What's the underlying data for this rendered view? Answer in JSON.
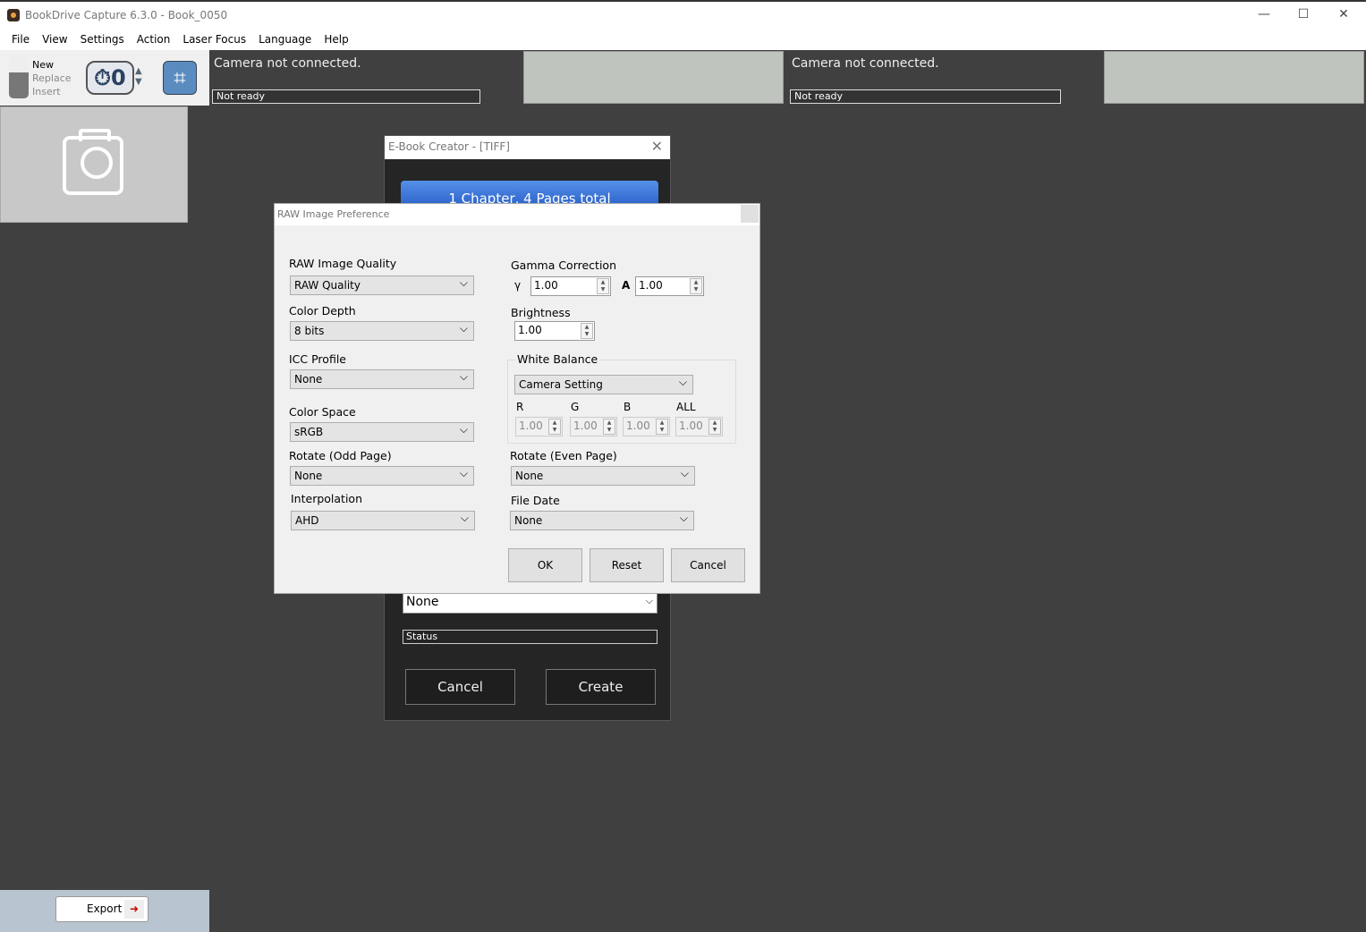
{
  "window": {
    "title": "BookDrive Capture 6.3.0 - Book_0050",
    "minimize": "—",
    "maximize": "☐",
    "close": "✕"
  },
  "menu": [
    "File",
    "View",
    "Settings",
    "Action",
    "Laser Focus",
    "Language",
    "Help"
  ],
  "toolbar": {
    "modes": [
      "New",
      "Replace",
      "Insert"
    ],
    "timer_value": "0",
    "crop_icon": "crop-icon"
  },
  "cameras": [
    {
      "message": "Camera not connected.",
      "status": "Not ready"
    },
    {
      "message": "Camera not connected.",
      "status": "Not ready"
    }
  ],
  "export_label": "Export",
  "ebook": {
    "title": "E-Book Creator - [TIFF]",
    "summary": "1 Chapter, 4 Pages total",
    "select_value": "None",
    "status": "Status",
    "cancel": "Cancel",
    "create": "Create"
  },
  "raw": {
    "title": "RAW Image Preference",
    "quality": {
      "label": "RAW Image Quality",
      "value": "RAW Quality"
    },
    "depth": {
      "label": "Color Depth",
      "value": "8 bits"
    },
    "icc": {
      "label": "ICC Profile",
      "value": "None"
    },
    "space": {
      "label": "Color Space",
      "value": "sRGB"
    },
    "rot_odd": {
      "label": "Rotate (Odd Page)",
      "value": "None"
    },
    "interp": {
      "label": "Interpolation",
      "value": "AHD"
    },
    "gamma": {
      "label": "Gamma Correction",
      "g_label": "γ",
      "g_value": "1.00",
      "a_label": "A",
      "a_value": "1.00"
    },
    "brightness": {
      "label": "Brightness",
      "value": "1.00"
    },
    "wb": {
      "label": "White Balance",
      "value": "Camera Setting",
      "r_label": "R",
      "r": "1.00",
      "g_label": "G",
      "g": "1.00",
      "b_label": "B",
      "b": "1.00",
      "all_label": "ALL",
      "all": "1.00"
    },
    "rot_even": {
      "label": "Rotate (Even Page)",
      "value": "None"
    },
    "file_date": {
      "label": "File Date",
      "value": "None"
    },
    "ok": "OK",
    "reset": "Reset",
    "cancel": "Cancel"
  }
}
